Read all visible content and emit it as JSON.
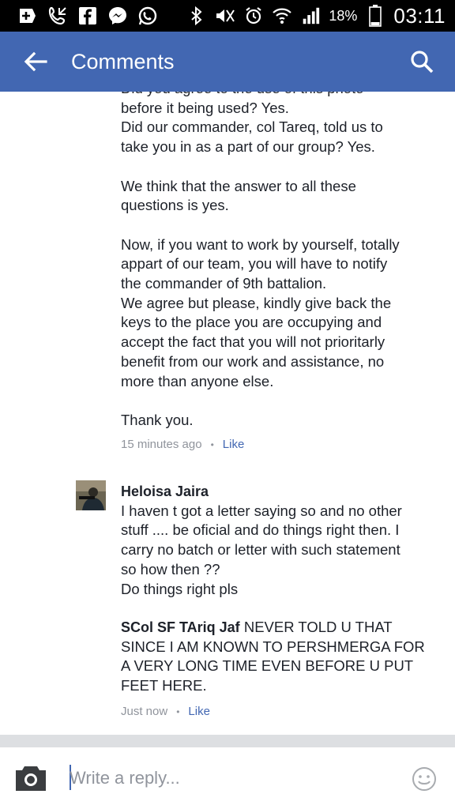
{
  "status_bar": {
    "battery_percent": "18%",
    "time": "03:11",
    "icons": [
      "plus-icon",
      "phone-icon",
      "facebook-icon",
      "messenger-icon",
      "whatsapp-icon",
      "bluetooth-icon",
      "mute-icon",
      "alarm-icon",
      "wifi-icon",
      "signal-icon",
      "battery-icon"
    ]
  },
  "header": {
    "title": "Comments",
    "back_icon": "arrow-left-icon",
    "search_icon": "search-icon",
    "background": "#4267b2"
  },
  "comments": [
    {
      "lines": [
        "Did you agree to the use of this photo",
        "before it being used? Yes.",
        "Did our commander, col Tareq, told us to",
        "take you in as a part of our group? Yes.",
        "",
        "We think that the answer to all these",
        "questions is yes.",
        "",
        "Now, if you want to work by yourself, totally",
        "appart of our team, you will have to notify",
        "the commander of 9th battalion.",
        "We agree but please, kindly give back the",
        "keys to the place you are occupying and",
        "accept the fact that you will not prioritarly",
        "benefit from our work and assistance, no",
        "more than anyone else.",
        "",
        "Thank you."
      ],
      "time": "15 minutes ago",
      "like": "Like"
    },
    {
      "author": "Heloisa Jaira",
      "lines": [
        "I haven t got  a letter saying so and no other",
        "stuff .... be oficial and do things right then. I",
        "carry no batch or letter with such statement",
        "so how then ??",
        "Do things right pls"
      ]
    },
    {
      "mention": "SCol SF TAriq Jaf",
      "lines": [
        "NEVER TOLD U THAT",
        "SINCE I AM KNOWN TO PERSHMERGA FOR",
        "A VERY LONG TIME EVEN BEFORE U PUT",
        "FEET HERE."
      ],
      "time": "Just now",
      "like": "Like"
    }
  ],
  "reply": {
    "placeholder": "Write a reply...",
    "camera_icon": "camera-icon",
    "emoji_icon": "emoji-icon"
  },
  "colors": {
    "link": "#4267b2",
    "meta": "#90949c",
    "text": "#1d2129"
  }
}
